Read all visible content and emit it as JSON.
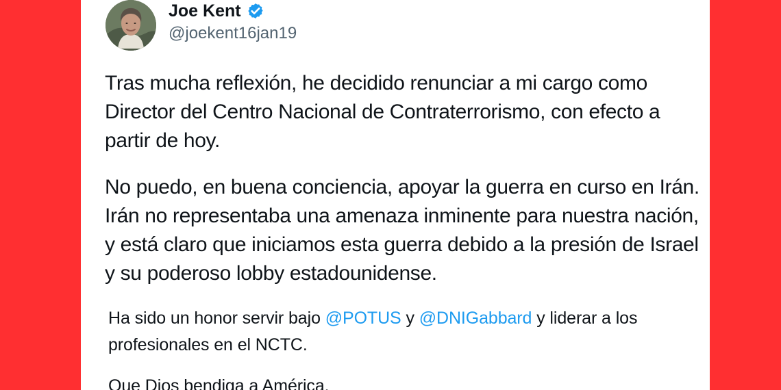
{
  "colors": {
    "background": "#ff2f31",
    "card": "#ffffff",
    "text": "#0f1419",
    "secondary_text": "#536471",
    "link": "#1d9bf0"
  },
  "author": {
    "name": "Joe Kent",
    "handle": "@joekent16jan19",
    "avatar_icon": "user-photo-icon",
    "verified_icon": "verified-badge-icon"
  },
  "post": {
    "paragraph_1": "Tras mucha reflexión, he decidido renunciar a mi cargo como Director del Centro Nacional de Contraterrorismo, con efecto a partir de hoy.",
    "paragraph_2": "No puedo, en buena conciencia, apoyar la guerra en curso en Irán. Irán no representaba una amenaza inminente para nuestra nación, y está claro que iniciamos esta guerra debido a la presión de Israel y su poderoso lobby estadounidense.",
    "paragraph_3": {
      "before_first_mention": "Ha sido un honor servir bajo ",
      "mention_1": "@POTUS",
      "between_mentions": " y ",
      "mention_2": "@DNIGabbard",
      "after_second_mention": " y liderar a los profesionales en el NCTC."
    },
    "paragraph_4": "Que Dios bendiga a América."
  }
}
